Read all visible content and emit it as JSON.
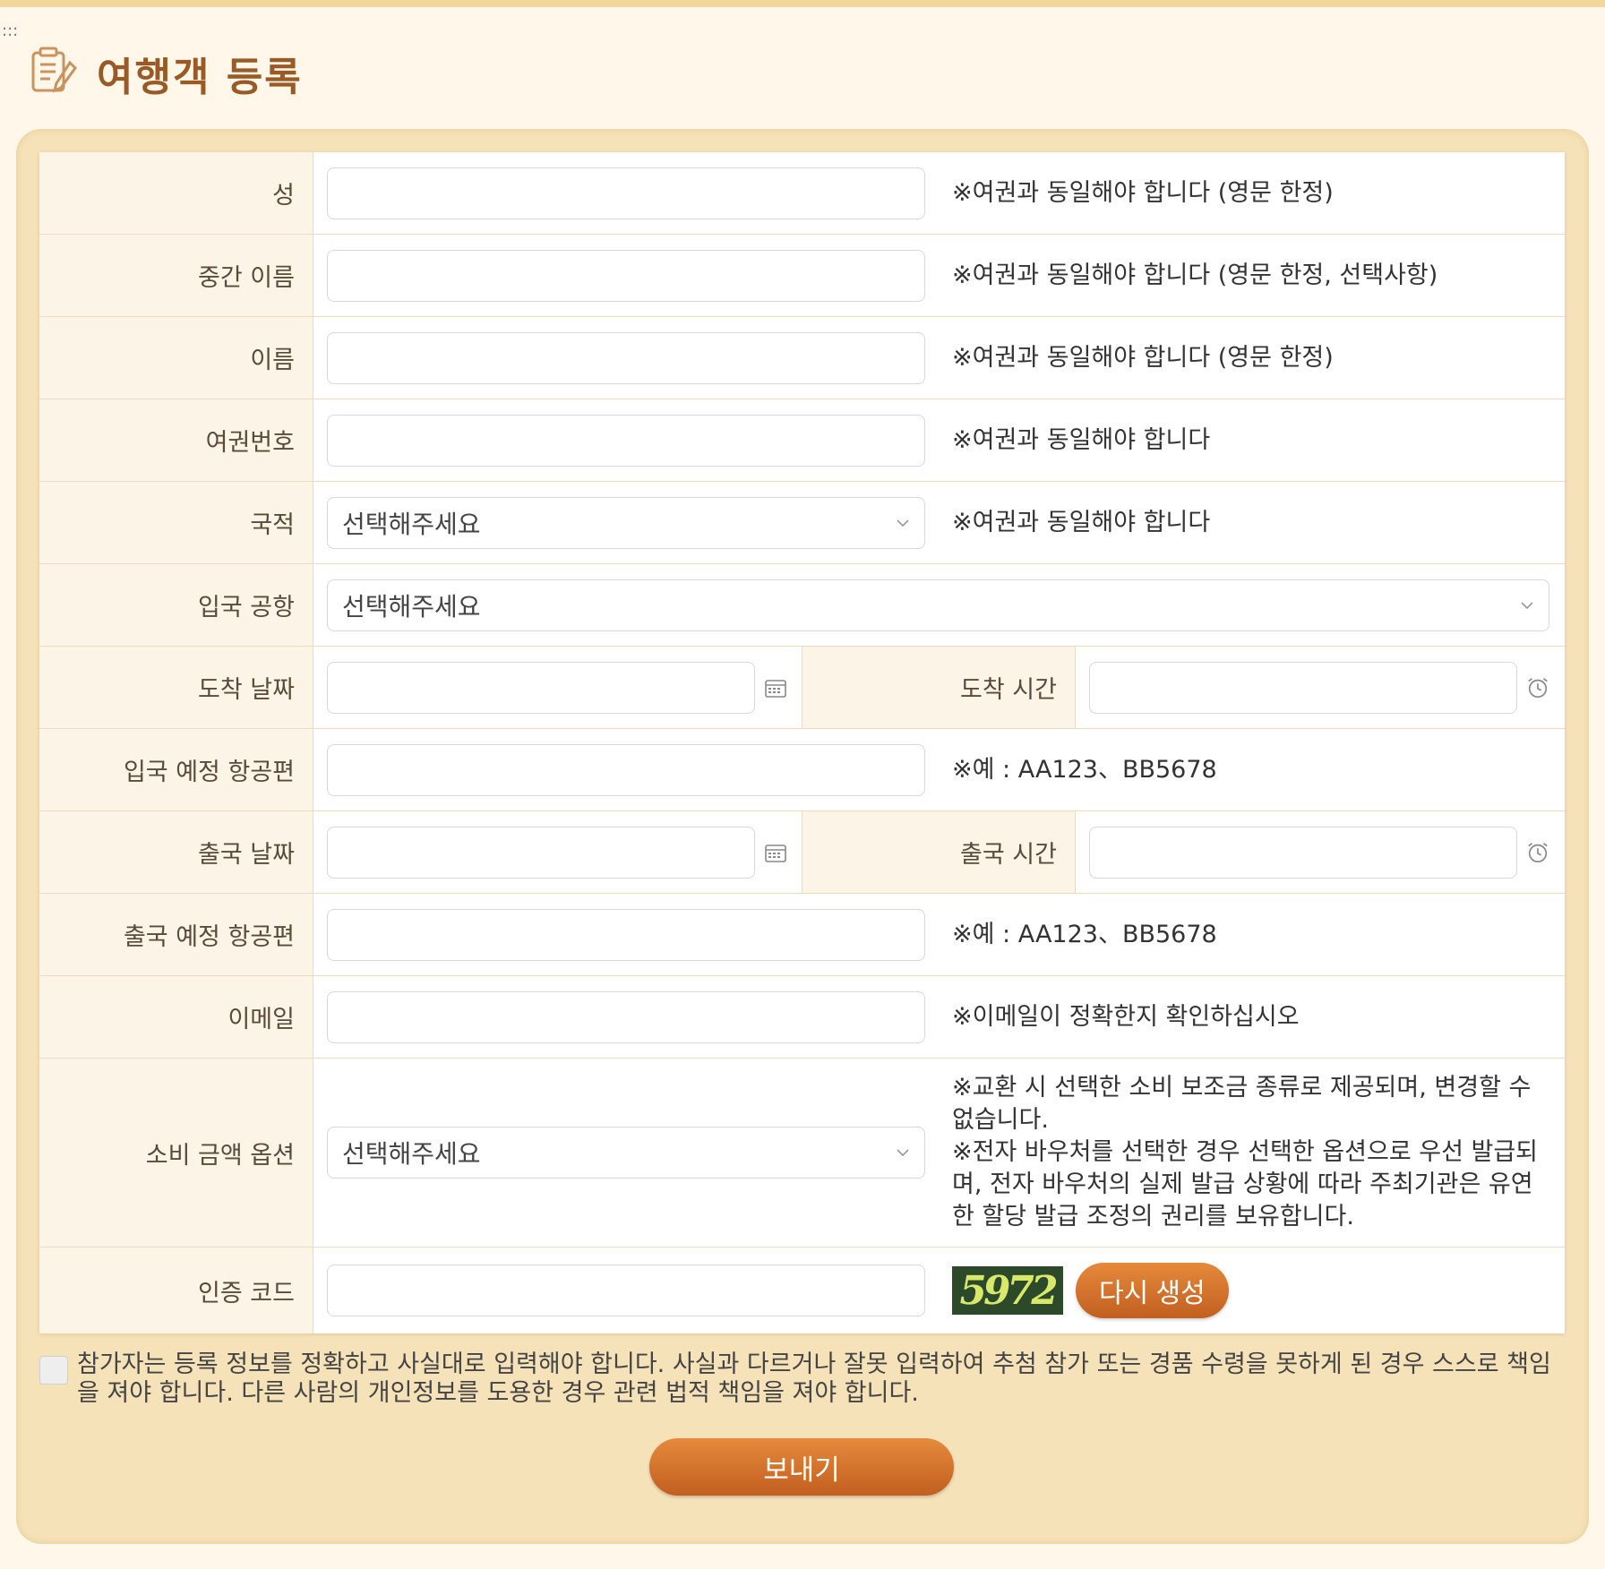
{
  "handle": ":::",
  "page_title": "여행객 등록",
  "fields": {
    "last_name": {
      "label": "성",
      "note": "※여권과 동일해야 합니다 (영문 한정)"
    },
    "middle_name": {
      "label": "중간 이름",
      "note": "※여권과 동일해야 합니다 (영문 한정, 선택사항)"
    },
    "first_name": {
      "label": "이름",
      "note": "※여권과 동일해야 합니다 (영문 한정)"
    },
    "passport": {
      "label": "여권번호",
      "note": "※여권과 동일해야 합니다"
    },
    "nationality": {
      "label": "국적",
      "value": "선택해주세요",
      "note": "※여권과 동일해야 합니다"
    },
    "airport": {
      "label": "입국 공항",
      "value": "선택해주세요"
    },
    "arrival_date": {
      "label": "도착 날짜"
    },
    "arrival_time": {
      "label": "도착 시간"
    },
    "arrival_flight": {
      "label": "입국 예정 항공편",
      "note": "※예 : AA123、BB5678"
    },
    "departure_date": {
      "label": "출국 날짜"
    },
    "departure_time": {
      "label": "출국 시간"
    },
    "departure_flight": {
      "label": "출국 예정 항공편",
      "note": "※예 : AA123、BB5678"
    },
    "email": {
      "label": "이메일",
      "note": "※이메일이 정확한지 확인하십시오"
    },
    "spending_option": {
      "label": "소비 금액 옵션",
      "value": "선택해주세요",
      "note_1": "※교환 시 선택한 소비 보조금 종류로 제공되며, 변경할 수 없습니다.",
      "note_2": "※전자 바우처를 선택한 경우 선택한 옵션으로 우선 발급되며, 전자 바우처의 실제 발급 상황에 따라 주최기관은 유연한 할당 발급 조정의 권리를 보유합니다."
    },
    "captcha": {
      "label": "인증 코드",
      "code": "5972",
      "regen_label": "다시 생성"
    }
  },
  "agreement": "참가자는 등록 정보를 정확하고 사실대로 입력해야 합니다. 사실과 다르거나 잘못 입력하여 추첨 참가 또는 경품 수령을 못하게 된 경우 스스로 책임을 져야 합니다. 다른 사람의 개인정보를 도용한 경우 관련 법적 책임을 져야 합니다.",
  "submit_label": "보내기",
  "colors": {
    "accent": "#c25f20",
    "title": "#9a5a25",
    "panel": "#f6e2b8",
    "background": "#fff7ea"
  }
}
